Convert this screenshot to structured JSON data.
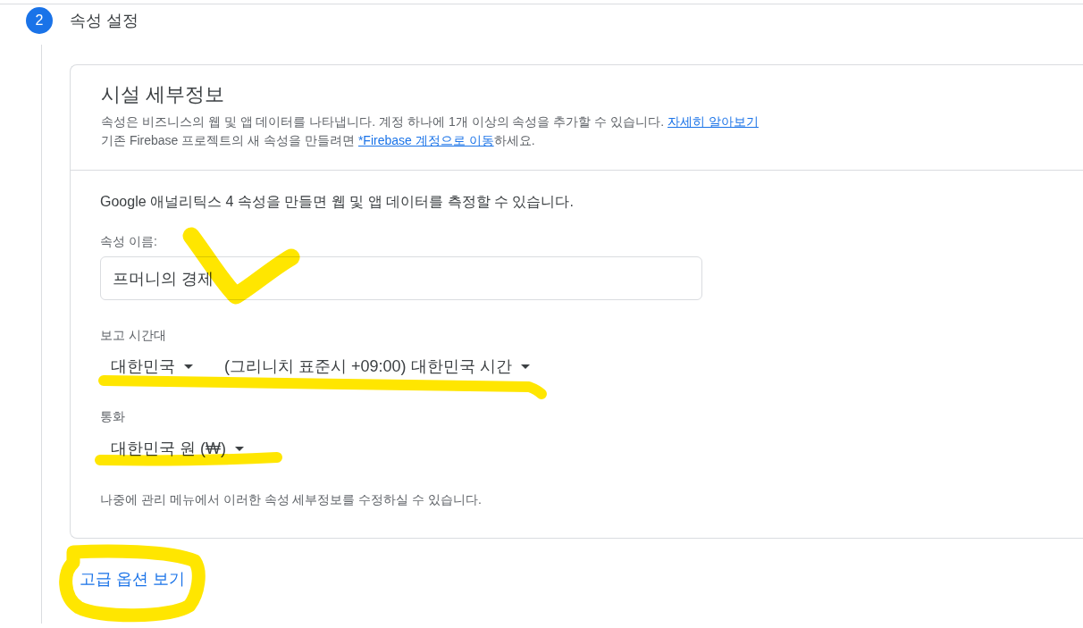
{
  "step": {
    "number": "2",
    "title": "속성 설정"
  },
  "card": {
    "title": "시설 세부정보",
    "description": [
      [
        {
          "kind": "text",
          "text": "속성은 비즈니스의 웹 및 앱 데이터를 나타냅니다. 계정 하나에 1개 이상의 속성을 추가할 수 있습니다."
        },
        {
          "kind": "link",
          "text": "자세히 알아보기"
        }
      ],
      [
        {
          "kind": "text",
          "text": "기존 Firebase 프로젝트의 새 속성을 만들려면"
        },
        {
          "kind": "link",
          "text": "*Firebase 계정으로 이동"
        },
        {
          "kind": "text",
          "text": "하세요."
        }
      ]
    ],
    "intro": "Google 애널리틱스 4 속성을 만들면 웹 및 앱 데이터를 측정할 수 있습니다.",
    "property_name": {
      "label": "속성 이름:",
      "value": "프머니의 경제"
    },
    "time_zone": {
      "label": "보고 시간대",
      "dropdowns": [
        "대한민국",
        "(그리니치 표준시 +09:00) 대한민국 시간"
      ]
    },
    "currency": {
      "label": "통화",
      "dropdowns": [
        "대한민국 원 (₩)"
      ]
    },
    "note": "나중에 관리 메뉴에서 이러한 속성 세부정보를 수정하실 수 있습니다."
  },
  "advanced_link": "고급 옵션 보기"
}
